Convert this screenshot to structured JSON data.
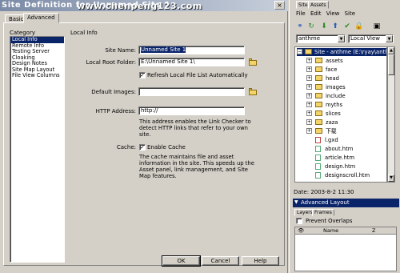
{
  "dialog": {
    "title": "Site Definition for Unnamed Site 1",
    "watermark": "www.chenpeng123.com",
    "close_glyph": "×",
    "tabs": [
      "Basic",
      "Advanced"
    ],
    "category_label": "Category",
    "categories": [
      "Local Info",
      "Remote Info",
      "Testing Server",
      "Cloaking",
      "Design Notes",
      "Site Map Layout",
      "File View Columns"
    ],
    "section_title": "Local Info",
    "site_name_label": "Site Name:",
    "site_name_value": "Unnamed Site 1",
    "root_folder_label": "Local Root Folder:",
    "root_folder_value": "E:\\Unnamed Site 1\\",
    "refresh_label": "Refresh Local File List Automatically",
    "default_images_label": "Default Images:",
    "default_images_value": "",
    "http_label": "HTTP Address:",
    "http_value": "http://",
    "http_help": "This address enables the Link Checker to detect HTTP links that refer to your own site.",
    "cache_label": "Cache:",
    "enable_cache_label": "Enable Cache",
    "cache_help": "The cache maintains file and asset information in the site. This speeds up the Asset panel, link management, and Site Map features.",
    "buttons": {
      "ok": "OK",
      "cancel": "Cancel",
      "help": "Help"
    }
  },
  "panel": {
    "tabs": [
      "Site",
      "Assets"
    ],
    "menus": [
      "File",
      "Edit",
      "View",
      "Site"
    ],
    "site_select": "anthme",
    "view_select": "Local View",
    "tree_root": "Site - anthme (E:\\ryay\\anthme)",
    "folders": [
      "assets",
      "face",
      "head",
      "images",
      "include",
      "myths",
      "slices",
      "zaza",
      "下载"
    ],
    "files": [
      "l.gxd",
      "about.htm",
      "article.htm",
      "design.htm",
      "designscroll.htm"
    ],
    "status": "Date: 2003-8-2 11:30",
    "advanced_layout": "Advanced Layout",
    "layer_tabs": [
      "Layers",
      "Frames"
    ],
    "prevent_overlaps": "Prevent Overlaps",
    "layer_columns": [
      "",
      "Name",
      "Z"
    ]
  }
}
